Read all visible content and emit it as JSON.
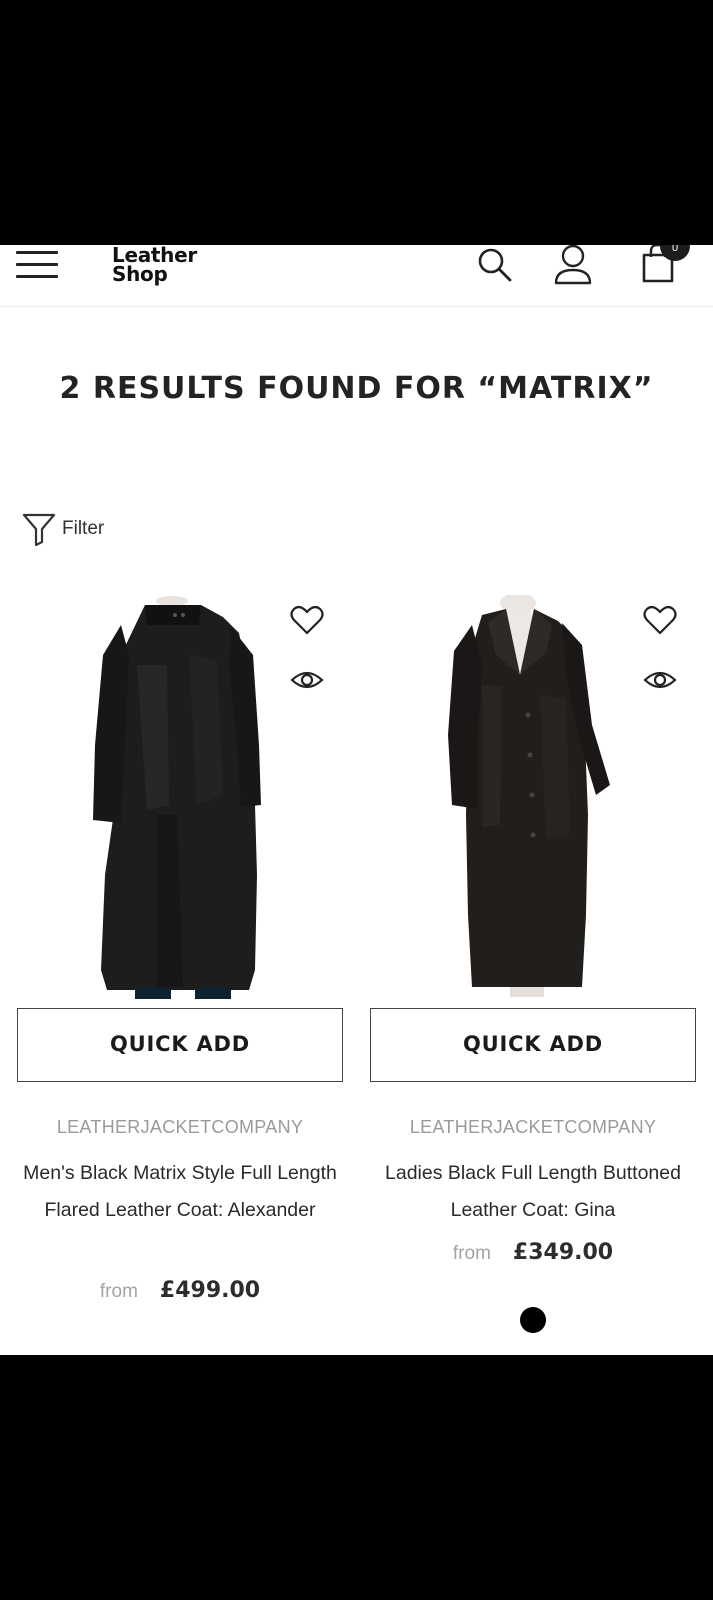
{
  "header": {
    "logo_line1": "Leather",
    "logo_line2": "Shop",
    "cart_count": "0"
  },
  "results_title": "2 RESULTS FOUND FOR “MATRIX”",
  "filter_label": "Filter",
  "products": [
    {
      "vendor": "LEATHERJACKETCOMPANY",
      "title": "Men's Black Matrix Style Full Length Flared Leather Coat: Alexander",
      "quick_add": "QUICK ADD",
      "from_label": "from",
      "price": "£499.00"
    },
    {
      "vendor": "LEATHERJACKETCOMPANY",
      "title": "Ladies Black Full Length Buttoned Leather Coat: Gina",
      "quick_add": "QUICK ADD",
      "from_label": "from",
      "price": "£349.00",
      "swatch_color": "#000000"
    }
  ],
  "icons": [
    "menu-icon",
    "search-icon",
    "account-icon",
    "cart-icon",
    "filter-icon",
    "heart-icon",
    "eye-icon"
  ]
}
